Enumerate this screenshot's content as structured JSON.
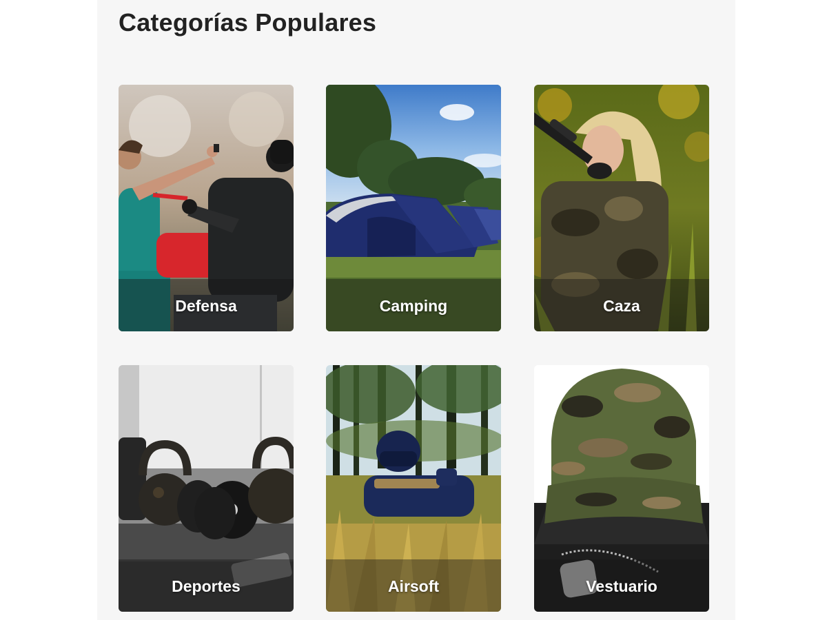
{
  "section": {
    "title": "Categorías Populares"
  },
  "categories": [
    {
      "label": "Defensa",
      "image": "defense-scene-image"
    },
    {
      "label": "Camping",
      "image": "tent-scene-image"
    },
    {
      "label": "Caza",
      "image": "hunter-scene-image"
    },
    {
      "label": "Deportes",
      "image": "kettlebells-scene-image"
    },
    {
      "label": "Airsoft",
      "image": "airsoft-scene-image"
    },
    {
      "label": "Vestuario",
      "image": "camo-cap-scene-image"
    }
  ]
}
